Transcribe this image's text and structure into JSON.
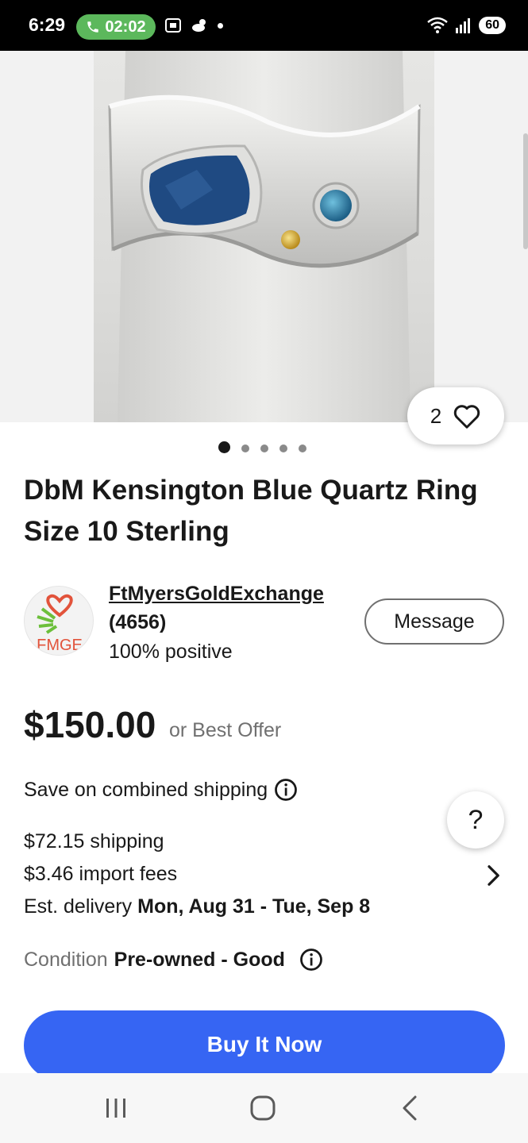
{
  "status_bar": {
    "time": "6:29",
    "call_timer": "02:02",
    "battery": "60"
  },
  "gallery": {
    "watch_count": "2",
    "image_count": 5,
    "active_image": 1
  },
  "listing": {
    "title": "DbM Kensington Blue Quartz Ring Size 10 Sterling"
  },
  "seller": {
    "avatar_text": "FMGE",
    "name": "FtMyersGoldExchange",
    "score": "(4656)",
    "positive": "100% positive",
    "message_label": "Message"
  },
  "price": {
    "amount": "$150.00",
    "best_offer": "or Best Offer"
  },
  "shipping": {
    "combined": "Save on combined shipping",
    "cost": "$72.15 shipping",
    "import_fees": "$3.46 import fees",
    "delivery_label": "Est. delivery",
    "delivery_dates": "Mon, Aug 31 - Tue, Sep 8"
  },
  "condition": {
    "label": "Condition",
    "value": "Pre-owned - Good"
  },
  "help_label": "?",
  "buy_now_label": "Buy It Now",
  "colors": {
    "buy_button": "#3665f3",
    "call_pill": "#5cb85c",
    "text_primary": "#191919",
    "text_secondary": "#707070"
  }
}
